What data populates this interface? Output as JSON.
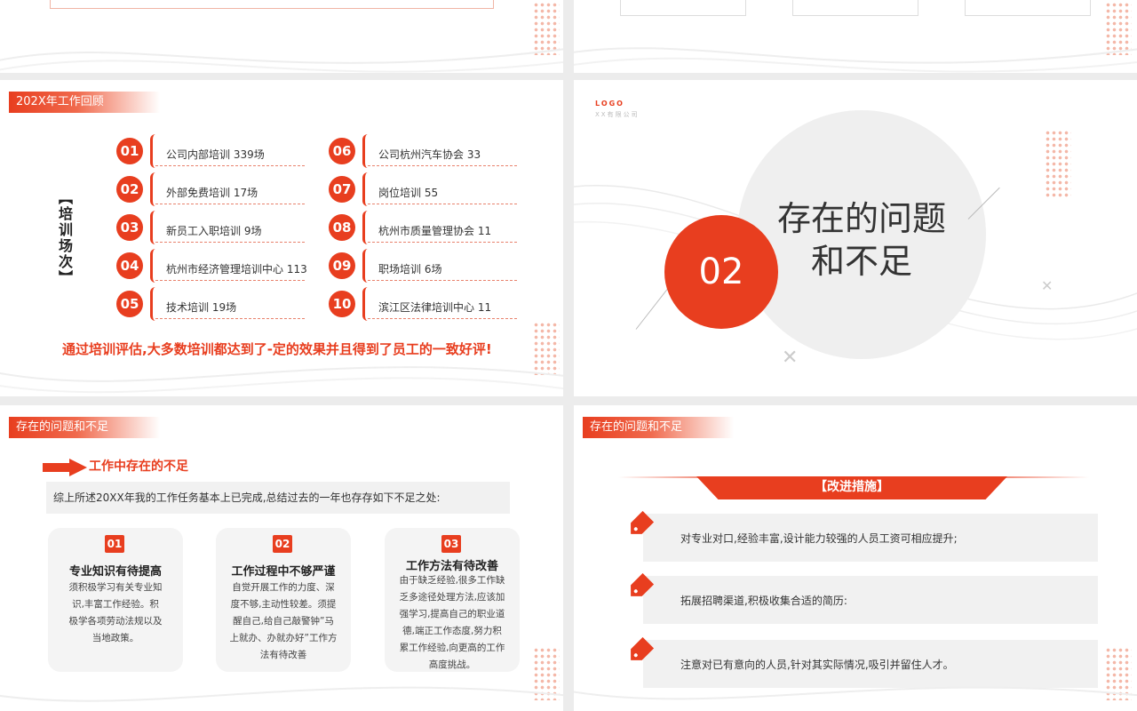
{
  "colors": {
    "accent": "#e83e1f",
    "light_bg": "#f1f1f1"
  },
  "slide_training": {
    "section_tag": "202X年工作回顾",
    "side_title": "【培训场次】",
    "items": [
      {
        "num": "01",
        "text": "公司内部培训 339场"
      },
      {
        "num": "02",
        "text": "外部免费培训 17场"
      },
      {
        "num": "03",
        "text": "新员工入职培训 9场"
      },
      {
        "num": "04",
        "text": "杭州市经济管理培训中心 113"
      },
      {
        "num": "05",
        "text": "技术培训 19场"
      },
      {
        "num": "06",
        "text": "公司杭州汽车协会 33"
      },
      {
        "num": "07",
        "text": "岗位培训 55"
      },
      {
        "num": "08",
        "text": "杭州市质量管理协会 11"
      },
      {
        "num": "09",
        "text": "职场培训 6场"
      },
      {
        "num": "10",
        "text": "滨江区法律培训中心 11"
      }
    ],
    "conclusion": "通过培训评估,大多数培训都达到了-定的效果并且得到了员工的一致好评!"
  },
  "slide_section": {
    "logo": "LOGO",
    "logo_sub": "XX有限公司",
    "number": "02",
    "title_line1": "存在的问题",
    "title_line2": "和不足"
  },
  "slide_problems": {
    "section_tag": "存在的问题和不足",
    "subtitle": "工作中存在的不足",
    "summary": "综上所述20XX年我的工作任务基本上已完成,总结过去的一年也存存如下不足之处:",
    "cards": [
      {
        "num": "01",
        "title": "专业知识有待提高",
        "body": "须积极学习有关专业知识,丰富工作经验。积极学各项劳动法规以及当地政策。"
      },
      {
        "num": "02",
        "title": "工作过程中不够严谨",
        "body": "自觉开展工作的力度、深度不够,主动性较差。须提醒自己,给自己敲警钟”马上就办、办就办好”工作方法有待改善"
      },
      {
        "num": "03",
        "title": "工作方法有待改善",
        "body": "由于缺乏经验,很多工作缺乏多途径处理方法,应该加强学习,提高自己的职业道德,端正工作态度,努力积累工作经验,向更高的工作高度挑战。"
      }
    ]
  },
  "slide_measures": {
    "section_tag": "存在的问题和不足",
    "banner": "【改进措施】",
    "items": [
      "对专业对口,经验丰富,设计能力较强的人员工资可相应提升;",
      "拓展招聘渠道,积极收集合适的简历:",
      "注意对已有意向的人员,针对其实际情况,吸引并留住人才。"
    ]
  }
}
